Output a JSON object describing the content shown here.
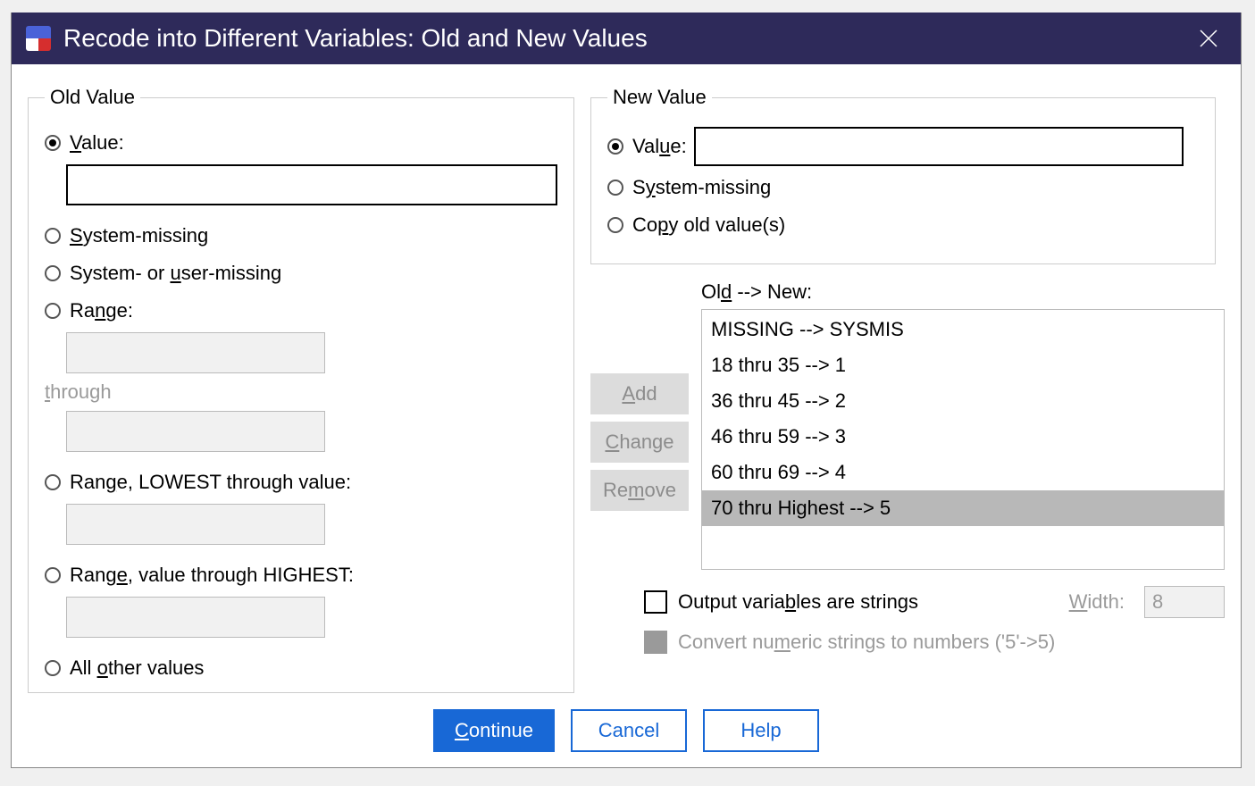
{
  "title": "Recode into Different Variables: Old and New Values",
  "oldValue": {
    "legend": "Old Value",
    "radios": {
      "value": "Value:",
      "systemMissing": "System-missing",
      "systemOrUserMissing": "System- or user-missing",
      "range": "Range:",
      "through": "through",
      "rangeLowest": "Range, LOWEST through value:",
      "rangeHighest": "Range, value through HIGHEST:",
      "allOther": "All other values"
    },
    "selected": "value",
    "valueInput": "",
    "rangeFrom": "",
    "rangeTo": "",
    "rangeLowestVal": "",
    "rangeHighestVal": ""
  },
  "newValue": {
    "legend": "New Value",
    "radios": {
      "value": "Value:",
      "systemMissing": "System-missing",
      "copyOld": "Copy old value(s)"
    },
    "selected": "value",
    "valueInput": ""
  },
  "mapping": {
    "label": "Old --> New:",
    "buttons": {
      "add": "Add",
      "change": "Change",
      "remove": "Remove"
    },
    "items": [
      "MISSING --> SYSMIS",
      "18 thru 35 --> 1",
      "36 thru 45 --> 2",
      "46 thru 59 --> 3",
      "60 thru 69 --> 4",
      "70 thru Highest --> 5"
    ],
    "selectedIndex": 5
  },
  "options": {
    "outputStrings": "Output variables are strings",
    "widthLabel": "Width:",
    "widthValue": "8",
    "convertNumeric": "Convert numeric strings to numbers ('5'->5)"
  },
  "footer": {
    "continue": "Continue",
    "cancel": "Cancel",
    "help": "Help"
  }
}
